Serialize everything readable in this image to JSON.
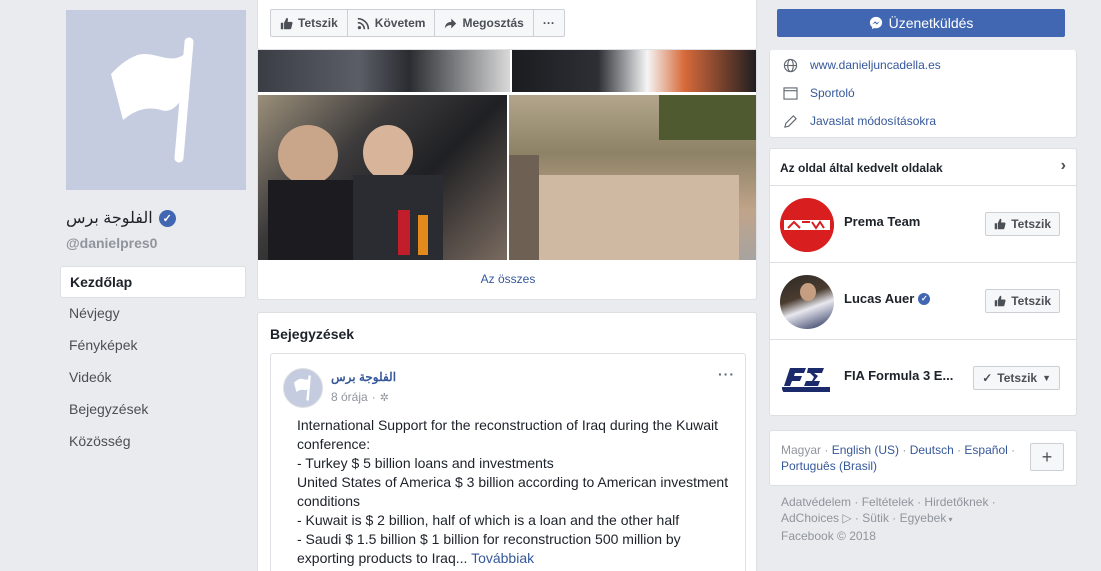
{
  "left": {
    "page_name": "الفلوجة برس",
    "handle": "@danielpres0",
    "nav": [
      {
        "label": "Kezdőlap",
        "active": true
      },
      {
        "label": "Névjegy"
      },
      {
        "label": "Fényképek"
      },
      {
        "label": "Videók"
      },
      {
        "label": "Bejegyzések"
      },
      {
        "label": "Közösség"
      }
    ]
  },
  "actions": {
    "like": "Tetszik",
    "follow": "Követem",
    "share": "Megosztás",
    "more": "···"
  },
  "photos": {
    "see_all": "Az összes"
  },
  "posts": {
    "title": "Bejegyzések",
    "author": "الفلوجة برس",
    "time": "8 órája",
    "more": "···",
    "lines": [
      "International Support for the reconstruction of Iraq during the Kuwait conference:",
      "- Turkey $ 5 billion loans and investments",
      "United States of America $ 3 billion according to American investment conditions",
      "- Kuwait is $ 2 billion, half of which is a loan and the other half",
      "- Saudi $ 1.5 billion $ 1 billion for reconstruction 500 million by exporting products to Iraq..."
    ],
    "read_more": "Továbbiak"
  },
  "right": {
    "message_button": "Üzenetküldés",
    "about": [
      {
        "icon": "globe-icon",
        "text": "www.danieljuncadella.es",
        "link": true
      },
      {
        "icon": "category-icon",
        "text": "Sportoló",
        "link": true
      },
      {
        "icon": "pencil-icon",
        "text": "Javaslat módosításokra",
        "link": true
      }
    ],
    "liked_title": "Az oldal által kedvelt oldalak",
    "liked": [
      {
        "name": "Prema Team",
        "button": "Tetszik",
        "verified": false,
        "liked": false
      },
      {
        "name": "Lucas Auer",
        "button": "Tetszik",
        "verified": true,
        "liked": false
      },
      {
        "name": "FIA Formula 3 E...",
        "button": "Tetszik",
        "verified": false,
        "liked": true
      }
    ],
    "languages": {
      "current": "Magyar",
      "others": [
        "English (US)",
        "Deutsch",
        "Español",
        "Português (Brasil)"
      ]
    },
    "footer": {
      "line1": [
        "Adatvédelem",
        "Feltételek",
        "Hirdetőknek"
      ],
      "line2": [
        "AdChoices",
        "Sütik",
        "Egyebek"
      ],
      "copyright": "Facebook © 2018"
    }
  },
  "colors": {
    "brand": "#4267b2",
    "link": "#365899",
    "background": "#e9ebee"
  }
}
